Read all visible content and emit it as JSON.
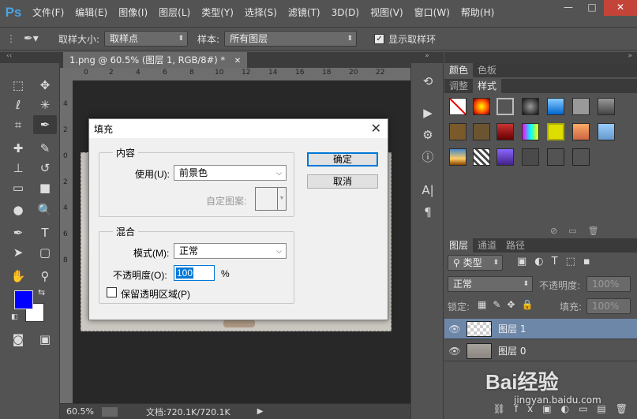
{
  "app": {
    "logo": "Ps"
  },
  "menu": [
    "文件(F)",
    "编辑(E)",
    "图像(I)",
    "图层(L)",
    "类型(Y)",
    "选择(S)",
    "滤镜(T)",
    "3D(D)",
    "视图(V)",
    "窗口(W)",
    "帮助(H)"
  ],
  "window_controls": {
    "minimize": "—",
    "maximize": "□",
    "close": "✕"
  },
  "options": {
    "sample_size_label": "取样大小:",
    "sample_size_value": "取样点",
    "sample_label": "样本:",
    "sample_value": "所有图层",
    "show_ring_label": "显示取样环",
    "show_ring_checked": true
  },
  "document": {
    "tab_title": "1.png @ 60.5% (图层 1, RGB/8#) *",
    "ruler_top": [
      "0",
      "2",
      "4",
      "6",
      "8",
      "10",
      "12",
      "14",
      "16",
      "18",
      "20",
      "22"
    ],
    "ruler_left": [
      "4",
      "2",
      "0",
      "2",
      "4",
      "6",
      "8"
    ]
  },
  "status": {
    "zoom": "60.5%",
    "doc_info": "文档:720.1K/720.1K"
  },
  "panels": {
    "color_tabs": [
      "颜色",
      "色板"
    ],
    "style_tabs": [
      "调整",
      "样式"
    ],
    "layers_tabs": [
      "图层",
      "通道",
      "路径"
    ],
    "filter_kind": "类型",
    "blend_mode": "正常",
    "opacity_label": "不透明度:",
    "opacity_value": "100%",
    "lock_label": "锁定:",
    "fill_label": "填充:",
    "fill_value": "100%",
    "layers": [
      {
        "name": "图层 1",
        "selected": true
      },
      {
        "name": "图层 0",
        "selected": false
      }
    ]
  },
  "colors": {
    "foreground": "#0000ff",
    "background": "#ffffff",
    "layer_selected": "#6d87a9"
  },
  "dialog": {
    "title": "填充",
    "content_group": "内容",
    "use_label": "使用(U):",
    "use_value": "前景色",
    "pattern_label": "自定图案:",
    "blend_group": "混合",
    "mode_label": "模式(M):",
    "mode_value": "正常",
    "opacity_label": "不透明度(O):",
    "opacity_value": "100",
    "opacity_unit": "%",
    "preserve_label": "保留透明区域(P)",
    "preserve_checked": false,
    "ok_label": "确定",
    "cancel_label": "取消"
  },
  "watermark": {
    "text": "Bai经验",
    "url": "jingyan.baidu.com"
  }
}
